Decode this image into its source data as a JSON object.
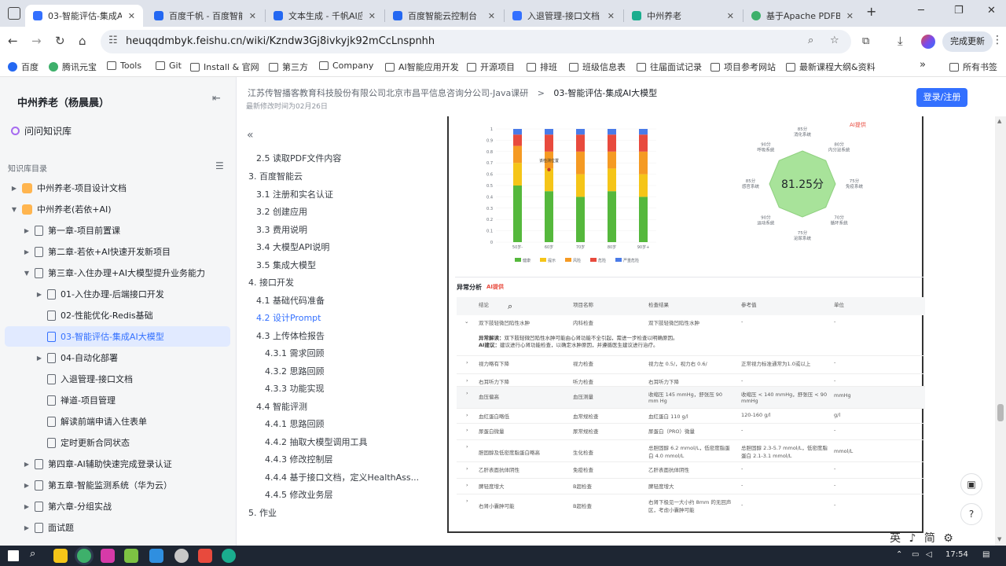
{
  "browser": {
    "tabs": [
      {
        "title": "03-智能评估-集成AI",
        "active": true,
        "color": "#3370ff"
      },
      {
        "title": "百度千帆 - 百度智能",
        "color": "#2468f2"
      },
      {
        "title": "文本生成 - 千帆AI应",
        "color": "#2468f2"
      },
      {
        "title": "百度智能云控制台",
        "color": "#2468f2"
      },
      {
        "title": "入退管理-接口文档",
        "color": "#3370ff"
      },
      {
        "title": "中州养老",
        "color": "#1aad8e"
      },
      {
        "title": "基于Apache PDFBo",
        "color": "#3eb06b"
      }
    ],
    "new_tab": "+",
    "url": "heuqqdmbyk.feishu.cn/wiki/Kzndw3Gj8ivkyjk92mCcLnspnhh",
    "update_label": "完成更新",
    "bookmarks": [
      "百度",
      "腾讯元宝",
      "Tools",
      "Git",
      "Install & 官网",
      "第三方",
      "Company",
      "AI智能应用开发",
      "开源项目",
      "排班",
      "班级信息表",
      "往届面试记录",
      "项目参考网站",
      "最新课程大纲&资料"
    ],
    "bookmarks_more": "»",
    "all_bookmarks": "所有书签"
  },
  "sidebar": {
    "title": "中州养老（杨晨晨）",
    "ask": "问问知识库",
    "kb_label": "知识库目录",
    "items": [
      {
        "label": "中州养老-项目设计文档"
      },
      {
        "label": "中州养老(若依+AI)"
      },
      {
        "label": "第一章-项目前置课"
      },
      {
        "label": "第二章-若依+AI快速开发新项目"
      },
      {
        "label": "第三章-入住办理+AI大模型提升业务能力"
      },
      {
        "label": "01-入住办理-后端接口开发"
      },
      {
        "label": "02-性能优化-Redis基础"
      },
      {
        "label": "03-智能评估-集成AI大模型"
      },
      {
        "label": "04-自动化部署"
      },
      {
        "label": "入退管理-接口文档"
      },
      {
        "label": "禅道-项目管理"
      },
      {
        "label": "解读前端申请入住表单"
      },
      {
        "label": "定时更新合同状态"
      },
      {
        "label": "第四章-AI辅助快速完成登录认证"
      },
      {
        "label": "第五章-智能监测系统（华为云）"
      },
      {
        "label": "第六章-分组实战"
      },
      {
        "label": "面试题"
      }
    ]
  },
  "header": {
    "breadcrumb_parent": "江苏传智播客教育科技股份有限公司北京市昌平信息咨询分公司-Java课研",
    "breadcrumb_sep": ">",
    "breadcrumb_current": "03-智能评估-集成AI大模型",
    "modified": "最新修改时间为02月26日",
    "login": "登录/注册"
  },
  "outline": {
    "toggle": "«",
    "items": [
      {
        "label": "2.5 读取PDF文件内容"
      },
      {
        "label": "3. 百度智能云"
      },
      {
        "label": "3.1 注册和实名认证"
      },
      {
        "label": "3.2 创建应用"
      },
      {
        "label": "3.3 费用说明"
      },
      {
        "label": "3.4 大模型API说明"
      },
      {
        "label": "3.5 集成大模型"
      },
      {
        "label": "4. 接口开发"
      },
      {
        "label": "4.1 基础代码准备"
      },
      {
        "label": "4.2 设计Prompt",
        "active": true
      },
      {
        "label": "4.3 上传体检报告"
      },
      {
        "label": "4.3.1 需求回顾"
      },
      {
        "label": "4.3.2 思路回顾"
      },
      {
        "label": "4.3.3 功能实现"
      },
      {
        "label": "4.4 智能评测"
      },
      {
        "label": "4.4.1 思路回顾"
      },
      {
        "label": "4.4.2 抽取大模型调用工具"
      },
      {
        "label": "4.4.3 修改控制层"
      },
      {
        "label": "4.4.4 基于接口文档，定义HealthAss..."
      },
      {
        "label": "4.4.5 修改业务层"
      },
      {
        "label": "5. 作业"
      }
    ]
  },
  "report": {
    "chart_data": [
      {
        "type": "bar",
        "stacked": true,
        "title": "",
        "categories": [
          "50岁-",
          "60岁",
          "70岁",
          "80岁",
          "90岁+"
        ],
        "series": [
          {
            "name": "健康",
            "color": "#55b83c",
            "values": [
              50,
              45,
              40,
              45,
              40
            ]
          },
          {
            "name": "提示",
            "color": "#f5c518",
            "values": [
              20,
              20,
              20,
              20,
              20
            ]
          },
          {
            "name": "风险",
            "color": "#f59a23",
            "values": [
              15,
              15,
              20,
              15,
              20
            ]
          },
          {
            "name": "危险",
            "color": "#e84a3d",
            "values": [
              10,
              15,
              15,
              15,
              15
            ]
          },
          {
            "name": "严重危险",
            "color": "#4a7be8",
            "values": [
              5,
              5,
              5,
              5,
              5
            ]
          }
        ],
        "ylim": [
          0,
          1
        ],
        "yticks": [
          "0",
          "0.1",
          "0.2",
          "0.3",
          "0.4",
          "0.5",
          "0.6",
          "0.7",
          "0.8",
          "0.9",
          "1"
        ],
        "annotation": "该检测位置"
      },
      {
        "type": "radar",
        "center_value": "81.25分",
        "tag": "AI提供",
        "axes": [
          {
            "name": "消化系统",
            "score": "85分"
          },
          {
            "name": "内分泌系统",
            "score": "80分"
          },
          {
            "name": "免疫系统",
            "score": "75分"
          },
          {
            "name": "循环系统",
            "score": "70分"
          },
          {
            "name": "泌尿系统",
            "score": "75分"
          },
          {
            "name": "运动系统",
            "score": "90分"
          },
          {
            "name": "感官系统",
            "score": "85分"
          },
          {
            "name": "呼吸系统",
            "score": "90分"
          }
        ]
      }
    ],
    "anomaly_title": "异常分析",
    "anomaly_tag": "AI提供",
    "table_headers": [
      "结论",
      "项目名称",
      "检查结果",
      "参考值",
      "单位"
    ],
    "rows": [
      {
        "c1": "双下肢轻微凹陷性水肿",
        "c2": "内科检查",
        "c3": "双下肢轻微凹陷性水肿",
        "c4": "-",
        "c5": "-"
      },
      {
        "c1": "视力略有下降",
        "c2": "视力检查",
        "c3": "视力左 0.5/，视力右 0.6/",
        "c4": "正常视力标准通常为1.0或以上",
        "c5": "-"
      },
      {
        "c1": "右耳听力下降",
        "c2": "听力检查",
        "c3": "右耳听力下降",
        "c4": "-",
        "c5": "-"
      },
      {
        "c1": "血压偏高",
        "c2": "血压测量",
        "c3": "收缩压 145 mmHg，舒张压 90 mm Hg",
        "c4": "收缩压 < 140 mmHg，舒张压 < 90 mmHg",
        "c5": "mmHg"
      },
      {
        "c1": "血红蛋白略低",
        "c2": "血常规检查",
        "c3": "血红蛋白 110 g/l",
        "c4": "120-160 g/l",
        "c5": "g/l"
      },
      {
        "c1": "尿蛋白微量",
        "c2": "尿常规检查",
        "c3": "尿蛋白（PRO）微量",
        "c4": "-",
        "c5": "-"
      },
      {
        "c1": "胆固醇及低密度脂蛋白略高",
        "c2": "生化检查",
        "c3": "总胆固醇 6.2 mmol/L，低密度脂蛋白 4.0 mmol/L",
        "c4": "总胆固醇 2.3-5.7 mmol/L，低密度脂蛋白 2.1-3.1 mmol/L",
        "c5": "mmol/L"
      },
      {
        "c1": "乙肝表面抗体阴性",
        "c2": "免疫检查",
        "c3": "乙肝表面抗体阴性",
        "c4": "-",
        "c5": "-"
      },
      {
        "c1": "脾轻度增大",
        "c2": "B超检查",
        "c3": "脾轻度增大",
        "c4": "-",
        "c5": "-"
      },
      {
        "c1": "右肾小囊肿可能",
        "c2": "B超检查",
        "c3": "右肾下极见一大小约 8mm 的无回声区，考虑小囊肿可能",
        "c4": "-",
        "c5": "-"
      }
    ],
    "detail_label": "异常解读：",
    "detail_text": "双下肢轻微凹陷性水肿可能由心肾功能不全引起，需进一步检查以明确原因。",
    "advice_label": "AI建议：",
    "advice_text": "建议进行心肾功能检查，以确定水肿原因，并遵循医生建议进行治疗。"
  },
  "ime": "英 ♪ 简 ⚙",
  "taskbar": {
    "time": "17:54"
  }
}
